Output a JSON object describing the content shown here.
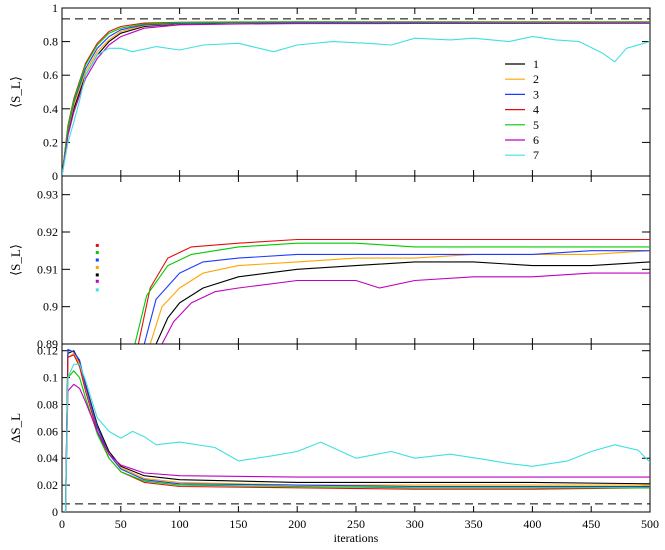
{
  "chart_data": [
    {
      "type": "line",
      "panel": "top",
      "ylabel": "⟨S_L⟩",
      "ylim": [
        0,
        1
      ],
      "xlim": [
        0,
        500
      ],
      "yticks": [
        "0",
        "0.2",
        "0.4",
        "0.6",
        "0.8",
        "1"
      ],
      "reference_line": {
        "y": 0.935,
        "style": "dashed",
        "color": "#000000"
      },
      "legend": {
        "placement": "center-right",
        "entries": [
          {
            "label": "1",
            "color": "#000000"
          },
          {
            "label": "2",
            "color": "#ffa500"
          },
          {
            "label": "3",
            "color": "#1e3cff"
          },
          {
            "label": "4",
            "color": "#e01010"
          },
          {
            "label": "5",
            "color": "#00cc00"
          },
          {
            "label": "6",
            "color": "#c000c0"
          },
          {
            "label": "7",
            "color": "#40e0e0"
          }
        ]
      },
      "series": [
        {
          "name": "1",
          "color": "#000000",
          "x": [
            0,
            5,
            10,
            20,
            30,
            40,
            50,
            70,
            100,
            150,
            200,
            300,
            400,
            500
          ],
          "y": [
            0,
            0.25,
            0.4,
            0.6,
            0.72,
            0.8,
            0.85,
            0.89,
            0.905,
            0.91,
            0.912,
            0.912,
            0.912,
            0.912
          ]
        },
        {
          "name": "2",
          "color": "#ffa500",
          "x": [
            0,
            5,
            10,
            20,
            30,
            40,
            50,
            70,
            100,
            150,
            200,
            300,
            400,
            500
          ],
          "y": [
            0,
            0.27,
            0.42,
            0.62,
            0.74,
            0.81,
            0.86,
            0.895,
            0.907,
            0.912,
            0.913,
            0.913,
            0.914,
            0.914
          ]
        },
        {
          "name": "3",
          "color": "#1e3cff",
          "x": [
            0,
            5,
            10,
            20,
            30,
            40,
            50,
            70,
            100,
            150,
            200,
            300,
            400,
            500
          ],
          "y": [
            0,
            0.28,
            0.44,
            0.64,
            0.76,
            0.83,
            0.87,
            0.9,
            0.909,
            0.913,
            0.914,
            0.914,
            0.915,
            0.915
          ]
        },
        {
          "name": "4",
          "color": "#e01010",
          "x": [
            0,
            5,
            10,
            20,
            30,
            40,
            50,
            70,
            100,
            150,
            200,
            300,
            400,
            500
          ],
          "y": [
            0,
            0.3,
            0.46,
            0.67,
            0.79,
            0.86,
            0.89,
            0.91,
            0.915,
            0.917,
            0.918,
            0.918,
            0.918,
            0.918
          ]
        },
        {
          "name": "5",
          "color": "#00cc00",
          "x": [
            0,
            5,
            10,
            20,
            30,
            40,
            50,
            70,
            100,
            150,
            200,
            300,
            400,
            500
          ],
          "y": [
            0,
            0.29,
            0.45,
            0.66,
            0.78,
            0.85,
            0.88,
            0.905,
            0.913,
            0.916,
            0.917,
            0.916,
            0.916,
            0.916
          ]
        },
        {
          "name": "6",
          "color": "#c000c0",
          "x": [
            0,
            5,
            10,
            20,
            30,
            40,
            50,
            70,
            100,
            150,
            200,
            300,
            400,
            500
          ],
          "y": [
            0,
            0.24,
            0.38,
            0.58,
            0.7,
            0.78,
            0.83,
            0.88,
            0.9,
            0.905,
            0.907,
            0.908,
            0.908,
            0.909
          ]
        },
        {
          "name": "7",
          "color": "#40e0e0",
          "x": [
            0,
            5,
            10,
            15,
            20,
            30,
            40,
            50,
            60,
            80,
            100,
            120,
            150,
            180,
            200,
            230,
            260,
            280,
            300,
            330,
            350,
            380,
            400,
            420,
            440,
            460,
            470,
            480,
            500
          ],
          "y": [
            0,
            0.2,
            0.32,
            0.45,
            0.6,
            0.72,
            0.76,
            0.76,
            0.74,
            0.77,
            0.75,
            0.78,
            0.79,
            0.74,
            0.78,
            0.8,
            0.79,
            0.78,
            0.82,
            0.81,
            0.82,
            0.8,
            0.83,
            0.81,
            0.8,
            0.73,
            0.68,
            0.76,
            0.8
          ]
        }
      ]
    },
    {
      "type": "line",
      "panel": "middle",
      "ylabel": "⟨S_L⟩",
      "ylim": [
        0.89,
        0.935
      ],
      "xlim": [
        0,
        500
      ],
      "yticks": [
        "0.89",
        "0.9",
        "0.91",
        "0.92",
        "0.93"
      ],
      "reference_line": {
        "y": 0.935,
        "style": "dashed",
        "color": "#000000"
      },
      "markers": [
        {
          "x": 30,
          "y": 0.9164,
          "color": "#e01010"
        },
        {
          "x": 30,
          "y": 0.9145,
          "color": "#00cc00"
        },
        {
          "x": 30,
          "y": 0.9125,
          "color": "#1e3cff"
        },
        {
          "x": 30,
          "y": 0.9105,
          "color": "#ffa500"
        },
        {
          "x": 30,
          "y": 0.9085,
          "color": "#000000"
        },
        {
          "x": 30,
          "y": 0.9068,
          "color": "#c000c0"
        },
        {
          "x": 30,
          "y": 0.9045,
          "color": "#40e0e0"
        }
      ],
      "series": [
        {
          "name": "1",
          "color": "#000000",
          "x": [
            80,
            90,
            100,
            120,
            150,
            200,
            250,
            300,
            350,
            400,
            450,
            500
          ],
          "y": [
            0.89,
            0.897,
            0.901,
            0.905,
            0.908,
            0.91,
            0.911,
            0.912,
            0.912,
            0.911,
            0.911,
            0.912
          ]
        },
        {
          "name": "2",
          "color": "#ffa500",
          "x": [
            75,
            85,
            100,
            120,
            150,
            200,
            250,
            300,
            350,
            400,
            450,
            500
          ],
          "y": [
            0.89,
            0.9,
            0.905,
            0.909,
            0.911,
            0.912,
            0.913,
            0.913,
            0.914,
            0.914,
            0.914,
            0.915
          ]
        },
        {
          "name": "3",
          "color": "#1e3cff",
          "x": [
            70,
            80,
            100,
            120,
            150,
            200,
            250,
            300,
            350,
            400,
            450,
            500
          ],
          "y": [
            0.89,
            0.902,
            0.909,
            0.912,
            0.913,
            0.914,
            0.914,
            0.914,
            0.914,
            0.914,
            0.915,
            0.915
          ]
        },
        {
          "name": "4",
          "color": "#e01010",
          "x": [
            65,
            75,
            90,
            110,
            150,
            200,
            250,
            300,
            350,
            400,
            450,
            500
          ],
          "y": [
            0.89,
            0.905,
            0.913,
            0.916,
            0.917,
            0.918,
            0.918,
            0.918,
            0.918,
            0.918,
            0.918,
            0.918
          ]
        },
        {
          "name": "5",
          "color": "#00cc00",
          "x": [
            62,
            72,
            90,
            110,
            150,
            200,
            250,
            300,
            350,
            400,
            450,
            500
          ],
          "y": [
            0.89,
            0.903,
            0.911,
            0.914,
            0.916,
            0.917,
            0.917,
            0.916,
            0.916,
            0.916,
            0.916,
            0.916
          ]
        },
        {
          "name": "6",
          "color": "#c000c0",
          "x": [
            85,
            95,
            110,
            130,
            150,
            200,
            250,
            270,
            300,
            350,
            400,
            450,
            500
          ],
          "y": [
            0.89,
            0.896,
            0.901,
            0.904,
            0.905,
            0.907,
            0.907,
            0.905,
            0.907,
            0.908,
            0.908,
            0.909,
            0.909
          ]
        }
      ]
    },
    {
      "type": "line",
      "panel": "bottom",
      "ylabel": "ΔS_L",
      "xlabel": "iterations",
      "ylim": [
        0,
        0.125
      ],
      "xlim": [
        0,
        500
      ],
      "yticks": [
        "0",
        "0.02",
        "0.04",
        "0.06",
        "0.08",
        "0.1",
        "0.12"
      ],
      "xticks": [
        "0",
        "50",
        "100",
        "150",
        "200",
        "250",
        "300",
        "350",
        "400",
        "450",
        "500"
      ],
      "reference_line": {
        "y": 0.006,
        "style": "dashed",
        "color": "#000000"
      },
      "series": [
        {
          "name": "1",
          "color": "#000000",
          "x": [
            3,
            5,
            10,
            15,
            20,
            30,
            40,
            50,
            70,
            100,
            200,
            300,
            400,
            500
          ],
          "y": [
            0,
            0.118,
            0.12,
            0.112,
            0.095,
            0.065,
            0.045,
            0.034,
            0.027,
            0.024,
            0.022,
            0.022,
            0.022,
            0.021
          ]
        },
        {
          "name": "2",
          "color": "#ffa500",
          "x": [
            3,
            5,
            10,
            15,
            20,
            30,
            40,
            50,
            70,
            100,
            200,
            300,
            400,
            500
          ],
          "y": [
            0,
            0.115,
            0.118,
            0.11,
            0.093,
            0.063,
            0.043,
            0.033,
            0.025,
            0.022,
            0.02,
            0.02,
            0.02,
            0.02
          ]
        },
        {
          "name": "3",
          "color": "#1e3cff",
          "x": [
            3,
            5,
            10,
            15,
            20,
            30,
            40,
            50,
            70,
            100,
            200,
            300,
            400,
            500
          ],
          "y": [
            0,
            0.121,
            0.119,
            0.113,
            0.094,
            0.063,
            0.043,
            0.032,
            0.024,
            0.021,
            0.02,
            0.019,
            0.019,
            0.019
          ]
        },
        {
          "name": "4",
          "color": "#e01010",
          "x": [
            3,
            5,
            10,
            15,
            20,
            30,
            40,
            50,
            70,
            100,
            200,
            300,
            400,
            500
          ],
          "y": [
            0,
            0.115,
            0.117,
            0.108,
            0.09,
            0.06,
            0.04,
            0.03,
            0.022,
            0.019,
            0.018,
            0.017,
            0.017,
            0.018
          ]
        },
        {
          "name": "5",
          "color": "#00cc00",
          "x": [
            3,
            5,
            10,
            15,
            20,
            30,
            40,
            50,
            70,
            100,
            200,
            300,
            400,
            500
          ],
          "y": [
            0,
            0.1,
            0.105,
            0.1,
            0.085,
            0.058,
            0.04,
            0.03,
            0.023,
            0.02,
            0.019,
            0.018,
            0.018,
            0.018
          ]
        },
        {
          "name": "6",
          "color": "#c000c0",
          "x": [
            3,
            5,
            10,
            15,
            20,
            30,
            40,
            50,
            70,
            100,
            200,
            300,
            400,
            500
          ],
          "y": [
            0,
            0.09,
            0.095,
            0.092,
            0.082,
            0.06,
            0.043,
            0.035,
            0.029,
            0.027,
            0.026,
            0.026,
            0.026,
            0.026
          ]
        },
        {
          "name": "7",
          "color": "#40e0e0",
          "x": [
            3,
            5,
            10,
            15,
            20,
            30,
            40,
            50,
            60,
            70,
            80,
            100,
            130,
            150,
            180,
            200,
            220,
            250,
            280,
            300,
            330,
            360,
            380,
            400,
            430,
            450,
            470,
            490,
            500
          ],
          "y": [
            0,
            0.1,
            0.11,
            0.11,
            0.098,
            0.07,
            0.06,
            0.055,
            0.06,
            0.056,
            0.05,
            0.052,
            0.048,
            0.038,
            0.042,
            0.045,
            0.052,
            0.04,
            0.045,
            0.04,
            0.043,
            0.039,
            0.036,
            0.034,
            0.038,
            0.045,
            0.05,
            0.046,
            0.037
          ]
        }
      ]
    }
  ]
}
